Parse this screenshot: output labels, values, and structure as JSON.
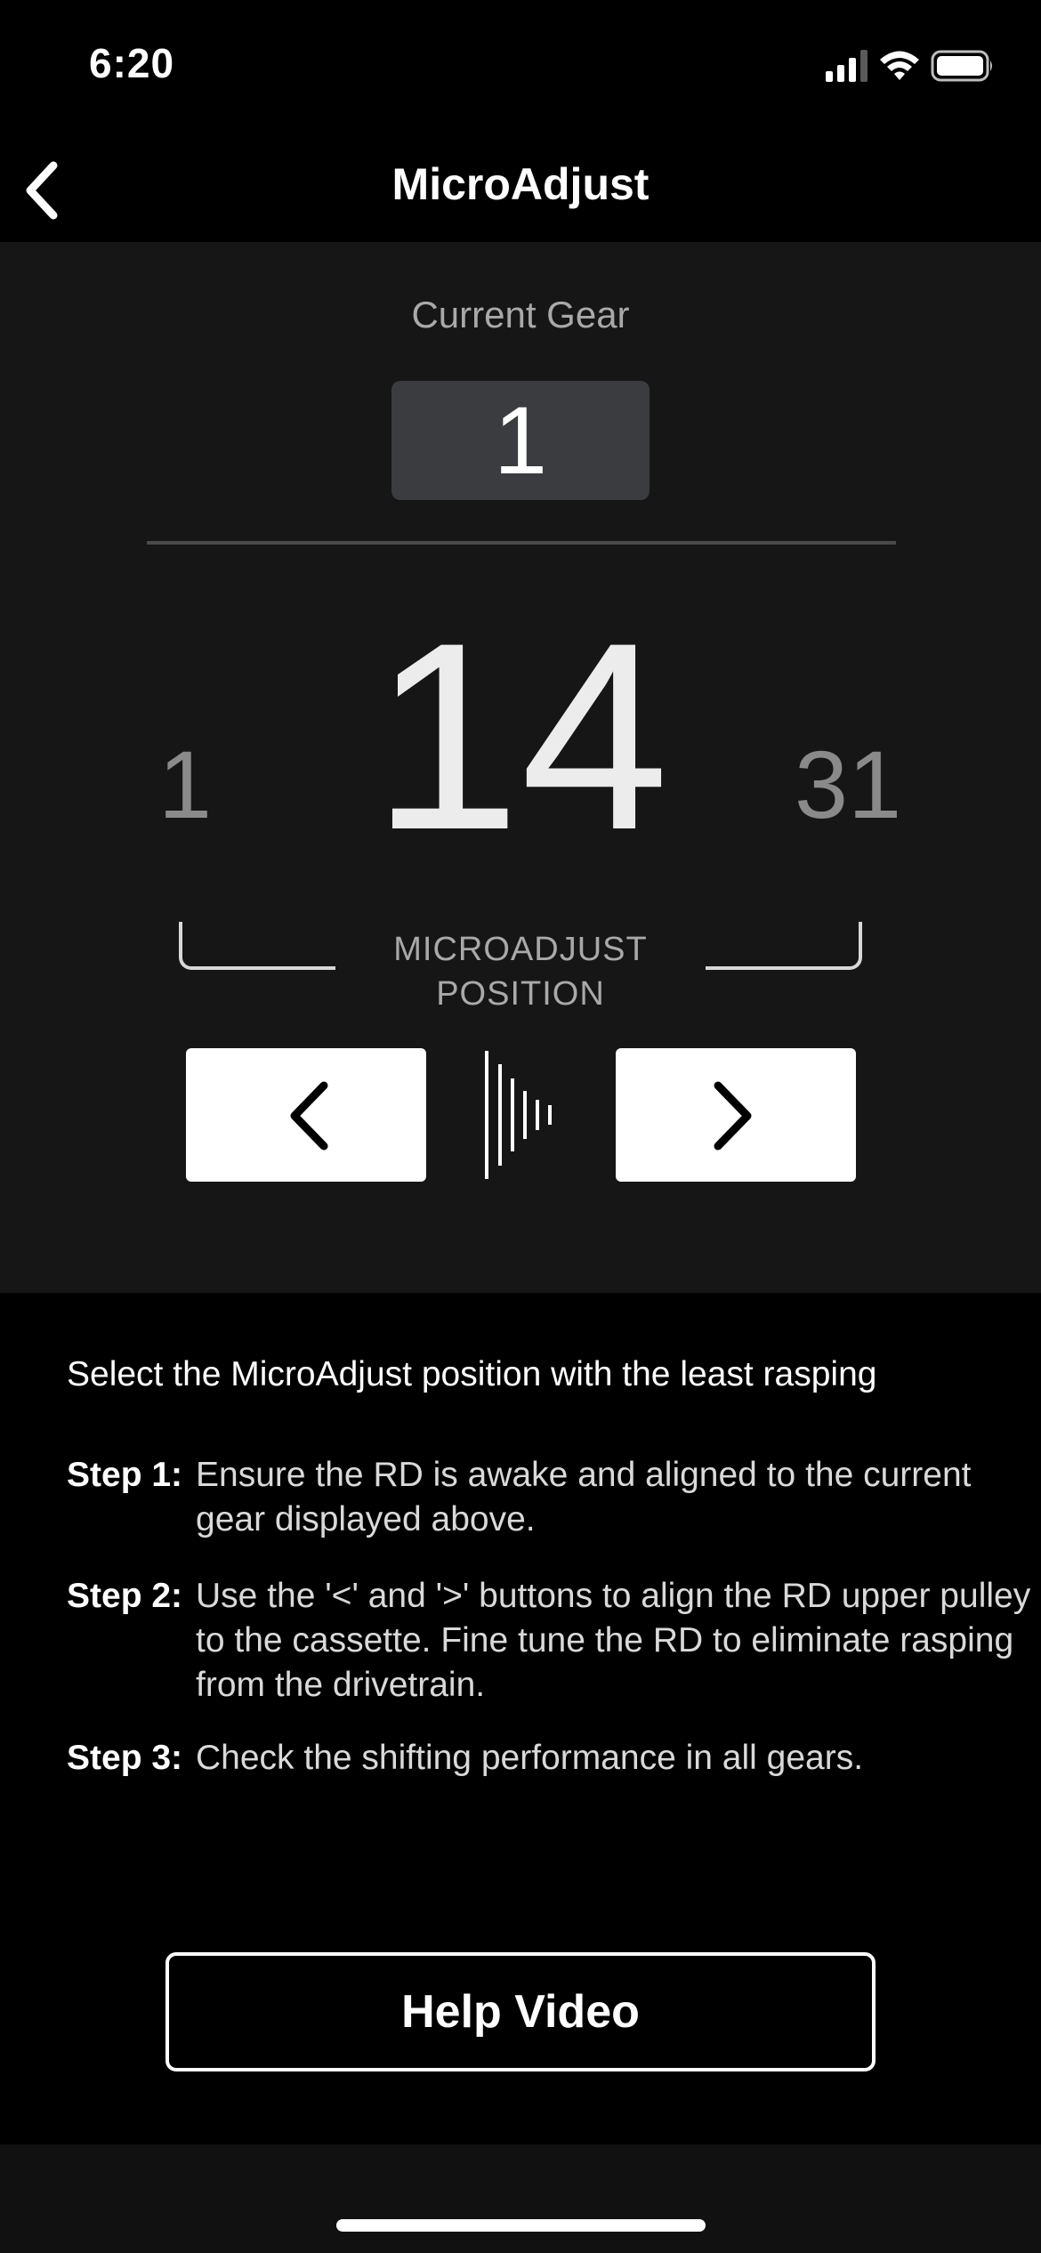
{
  "status_bar": {
    "time": "6:20"
  },
  "nav": {
    "title": "MicroAdjust",
    "back_icon": "chevron-left-icon"
  },
  "gear": {
    "label": "Current Gear",
    "value": "1"
  },
  "microadjust": {
    "min": "1",
    "max": "31",
    "position": "14",
    "label_line1": "MICROADJUST",
    "label_line2": "POSITION",
    "decrease_icon": "chevron-left-icon",
    "increase_icon": "chevron-right-icon",
    "sound_icon": "sound-wave-icon"
  },
  "instructions": {
    "intro": "Select the MicroAdjust position with the least rasping",
    "steps": [
      {
        "label": "Step 1:",
        "text": "Ensure the RD is awake and aligned to the current gear displayed above."
      },
      {
        "label": "Step 2:",
        "text": "Use the '<' and '>' buttons to align the RD upper pulley to the cassette. Fine tune the RD to eliminate rasping from the drivetrain."
      },
      {
        "label": "Step 3:",
        "text": "Check the shifting performance in all gears."
      }
    ]
  },
  "help_video": {
    "label": "Help Video"
  },
  "colors": {
    "background": "#000000",
    "panel": "#161616",
    "gear_box": "#3a3c3f",
    "muted_text": "#8a8a8a",
    "button": "#ffffff"
  }
}
